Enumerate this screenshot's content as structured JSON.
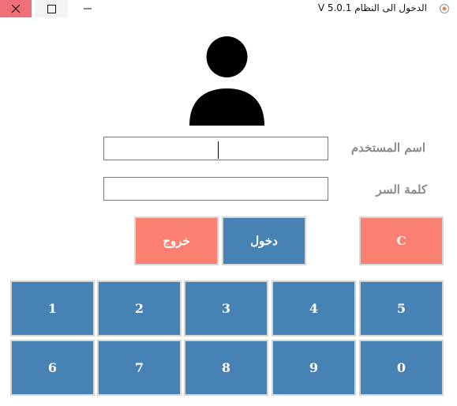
{
  "window": {
    "title": "الدخول الى النظام  V 5.0.1"
  },
  "form": {
    "username_label": "اسم المستخدم",
    "password_label": "كلمة السر",
    "username_value": "",
    "password_value": ""
  },
  "buttons": {
    "exit": "خروج",
    "login": "دخول",
    "clear": "C"
  },
  "keypad": {
    "row1": [
      "1",
      "2",
      "3",
      "4",
      "5"
    ],
    "row2": [
      "6",
      "7",
      "8",
      "9",
      "0"
    ]
  },
  "colors": {
    "primary": "#4682b4",
    "danger": "#fa8072",
    "label": "#8a8a8a"
  },
  "icons": {
    "avatar": "user-silhouette-icon",
    "close": "close-icon",
    "maximize": "maximize-icon",
    "minimize": "minimize-icon"
  }
}
